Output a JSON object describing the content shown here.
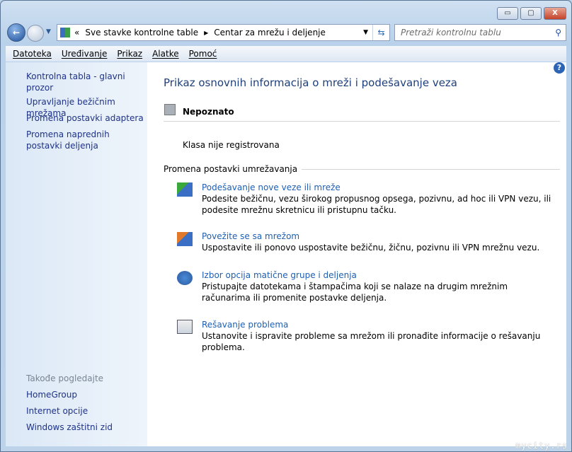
{
  "window": {
    "minimize": "▭",
    "maximize": "▢",
    "close": "X"
  },
  "address": {
    "overflow": "«",
    "crumbs": [
      "Sve stavke kontrolne table",
      "Centar za mrežu i deljenje"
    ]
  },
  "search": {
    "placeholder": "Pretraži kontrolnu tablu"
  },
  "menu": [
    "Datoteka",
    "Uređivanje",
    "Prikaz",
    "Alatke",
    "Pomoć"
  ],
  "sidebar": {
    "links": [
      "Kontrolna tabla - glavni prozor",
      "Upravljanje bežičnim mrežama",
      "Promena postavki adaptera",
      "Promena naprednih postavki deljenja"
    ],
    "see_also_title": "Takođe pogledajte",
    "see_also": [
      "HomeGroup",
      "Internet opcije",
      "Windows zaštitni zid"
    ]
  },
  "main": {
    "title": "Prikaz osnovnih informacija o mreži i podešavanje veza",
    "network_name": "Nepoznato",
    "network_status": "Klasa nije registrovana",
    "section": "Promena postavki umrežavanja",
    "tasks": [
      {
        "title": "Podešavanje nove veze ili mreže",
        "desc": "Podesite bežičnu, vezu širokog propusnog opsega, pozivnu, ad hoc ili VPN vezu, ili podesite mrežnu skretnicu ili pristupnu tačku."
      },
      {
        "title": "Povežite se sa mrežom",
        "desc": "Uspostavite ili ponovo uspostavite bežičnu, žičnu, pozivnu ili VPN mrežnu vezu."
      },
      {
        "title": "Izbor opcija matične grupe i deljenja",
        "desc": "Pristupajte datotekama i štampačima koji se nalaze na drugim mrežnim računarima ili promenite postavke deljenja."
      },
      {
        "title": "Rešavanje problema",
        "desc": "Ustanovite i ispravite probleme sa mrežom ili pronađite informacije o rešavanju problema."
      }
    ]
  },
  "help": "?",
  "watermark": "mycity.rs"
}
